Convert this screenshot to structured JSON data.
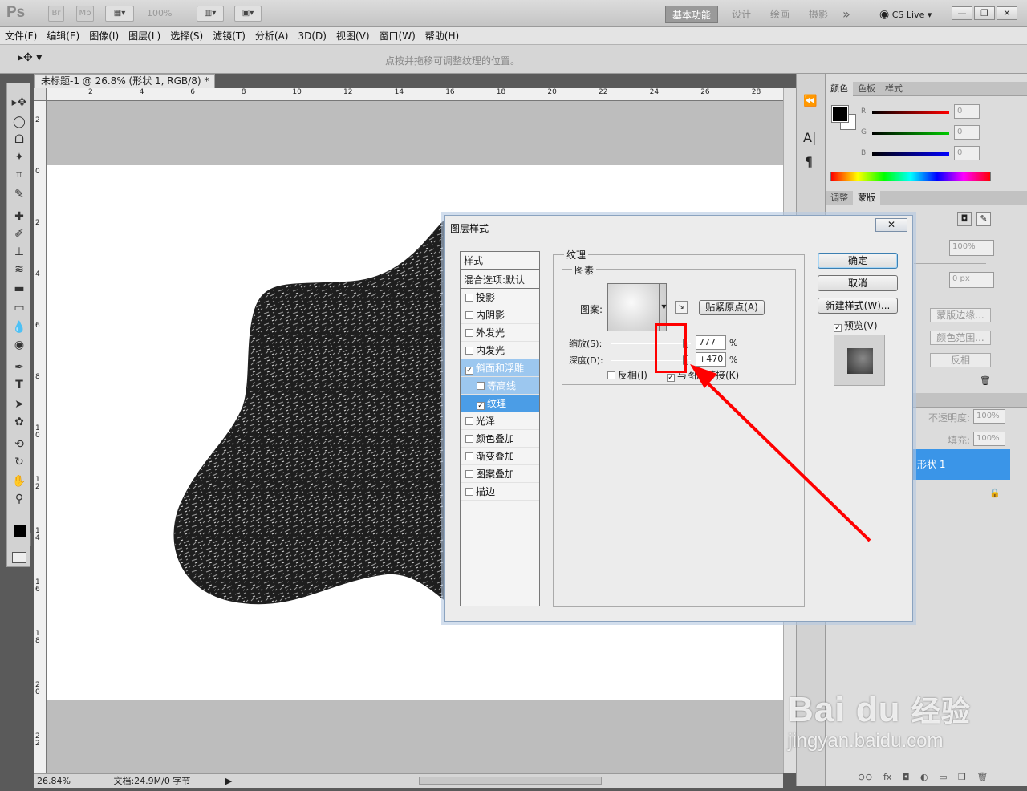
{
  "app": {
    "logo": "Ps",
    "br": "Br",
    "mb": "Mb",
    "zoom": "100%",
    "workspaces": [
      "基本功能",
      "设计",
      "绘画",
      "摄影"
    ],
    "more": "»",
    "cslive": "CS Live",
    "winbtns": [
      "—",
      "❐",
      "✕"
    ]
  },
  "menu": [
    "文件(F)",
    "编辑(E)",
    "图像(I)",
    "图层(L)",
    "选择(S)",
    "滤镜(T)",
    "分析(A)",
    "3D(D)",
    "视图(V)",
    "窗口(W)",
    "帮助(H)"
  ],
  "options": {
    "hint": "点按并拖移可调整纹理的位置。"
  },
  "document": {
    "tab": "未标题-1 @ 26.8% (形状 1, RGB/8) *",
    "hruler": [
      "2",
      "4",
      "6",
      "8",
      "10",
      "12",
      "14",
      "16",
      "18",
      "20",
      "22",
      "24",
      "26",
      "28"
    ],
    "vruler": [
      "2",
      "0",
      "2",
      "4",
      "6",
      "8",
      "1\n0",
      "1\n2",
      "1\n4",
      "1\n6",
      "1\n8",
      "2\n0",
      "2\n2"
    ],
    "status_zoom": "26.84%",
    "status_doc": "文档:24.9M/0 字节"
  },
  "tools": [
    "▸✥",
    "◯",
    "ᗝ",
    "✦",
    "⌗",
    "✎",
    "✚",
    "✐",
    "⊥",
    "≋",
    "▬",
    "▭",
    "💧",
    "◉",
    "✒",
    "T",
    "➤",
    "✿",
    "⟲",
    "↻",
    "✋",
    "⚲"
  ],
  "color_panel": {
    "tabs": [
      "颜色",
      "色板",
      "样式"
    ],
    "labels": [
      "R",
      "G",
      "B"
    ],
    "values": [
      "0",
      "0",
      "0"
    ]
  },
  "adjust_panel": {
    "tabs": [
      "调整",
      "蒙版"
    ],
    "density": "100%",
    "feather": "0 px",
    "buttons": [
      "蒙版边缘...",
      "颜色范围...",
      "反相"
    ]
  },
  "layers_panel": {
    "opacity_label": "不透明度:",
    "opacity": "100%",
    "fill_label": "填充:",
    "fill": "100%",
    "layer": "形状 1",
    "bottom_icons": [
      "⊖⊖",
      "fx",
      "◘",
      "◐",
      "▭",
      "❒",
      "🗑"
    ]
  },
  "dialog": {
    "title": "图层样式",
    "close": "✕",
    "styles_header": "样式",
    "blend_header": "混合选项:默认",
    "items": [
      {
        "label": "投影",
        "checked": false
      },
      {
        "label": "内阴影",
        "checked": false
      },
      {
        "label": "外发光",
        "checked": false
      },
      {
        "label": "内发光",
        "checked": false
      },
      {
        "label": "斜面和浮雕",
        "checked": true
      },
      {
        "label": "等高线",
        "checked": false
      },
      {
        "label": "纹理",
        "checked": true
      },
      {
        "label": "光泽",
        "checked": false
      },
      {
        "label": "颜色叠加",
        "checked": false
      },
      {
        "label": "渐变叠加",
        "checked": false
      },
      {
        "label": "图案叠加",
        "checked": false
      },
      {
        "label": "描边",
        "checked": false
      }
    ],
    "group_title": "纹理",
    "subgroup_title": "图素",
    "pattern_label": "图案:",
    "snap_button": "贴紧原点(A)",
    "scale_label": "缩放(S):",
    "scale_value": "777",
    "scale_fraction": 0.94,
    "depth_label": "深度(D):",
    "depth_value": "+470",
    "depth_fraction": 0.935,
    "percent": "%",
    "invert_label": "反相(I)",
    "invert_checked": false,
    "link_label": "与图层链接(K)",
    "link_checked": true,
    "ok": "确定",
    "cancel": "取消",
    "new_style": "新建样式(W)...",
    "preview_label": "预览(V)",
    "preview_checked": true
  },
  "watermark": {
    "brand": "Bai du",
    "cn": "经验",
    "url": "jingyan.baidu.com"
  },
  "colors": {
    "accent": "#4b9de6",
    "annotation": "#ff0000",
    "layer_selected": "#3a95e8"
  }
}
